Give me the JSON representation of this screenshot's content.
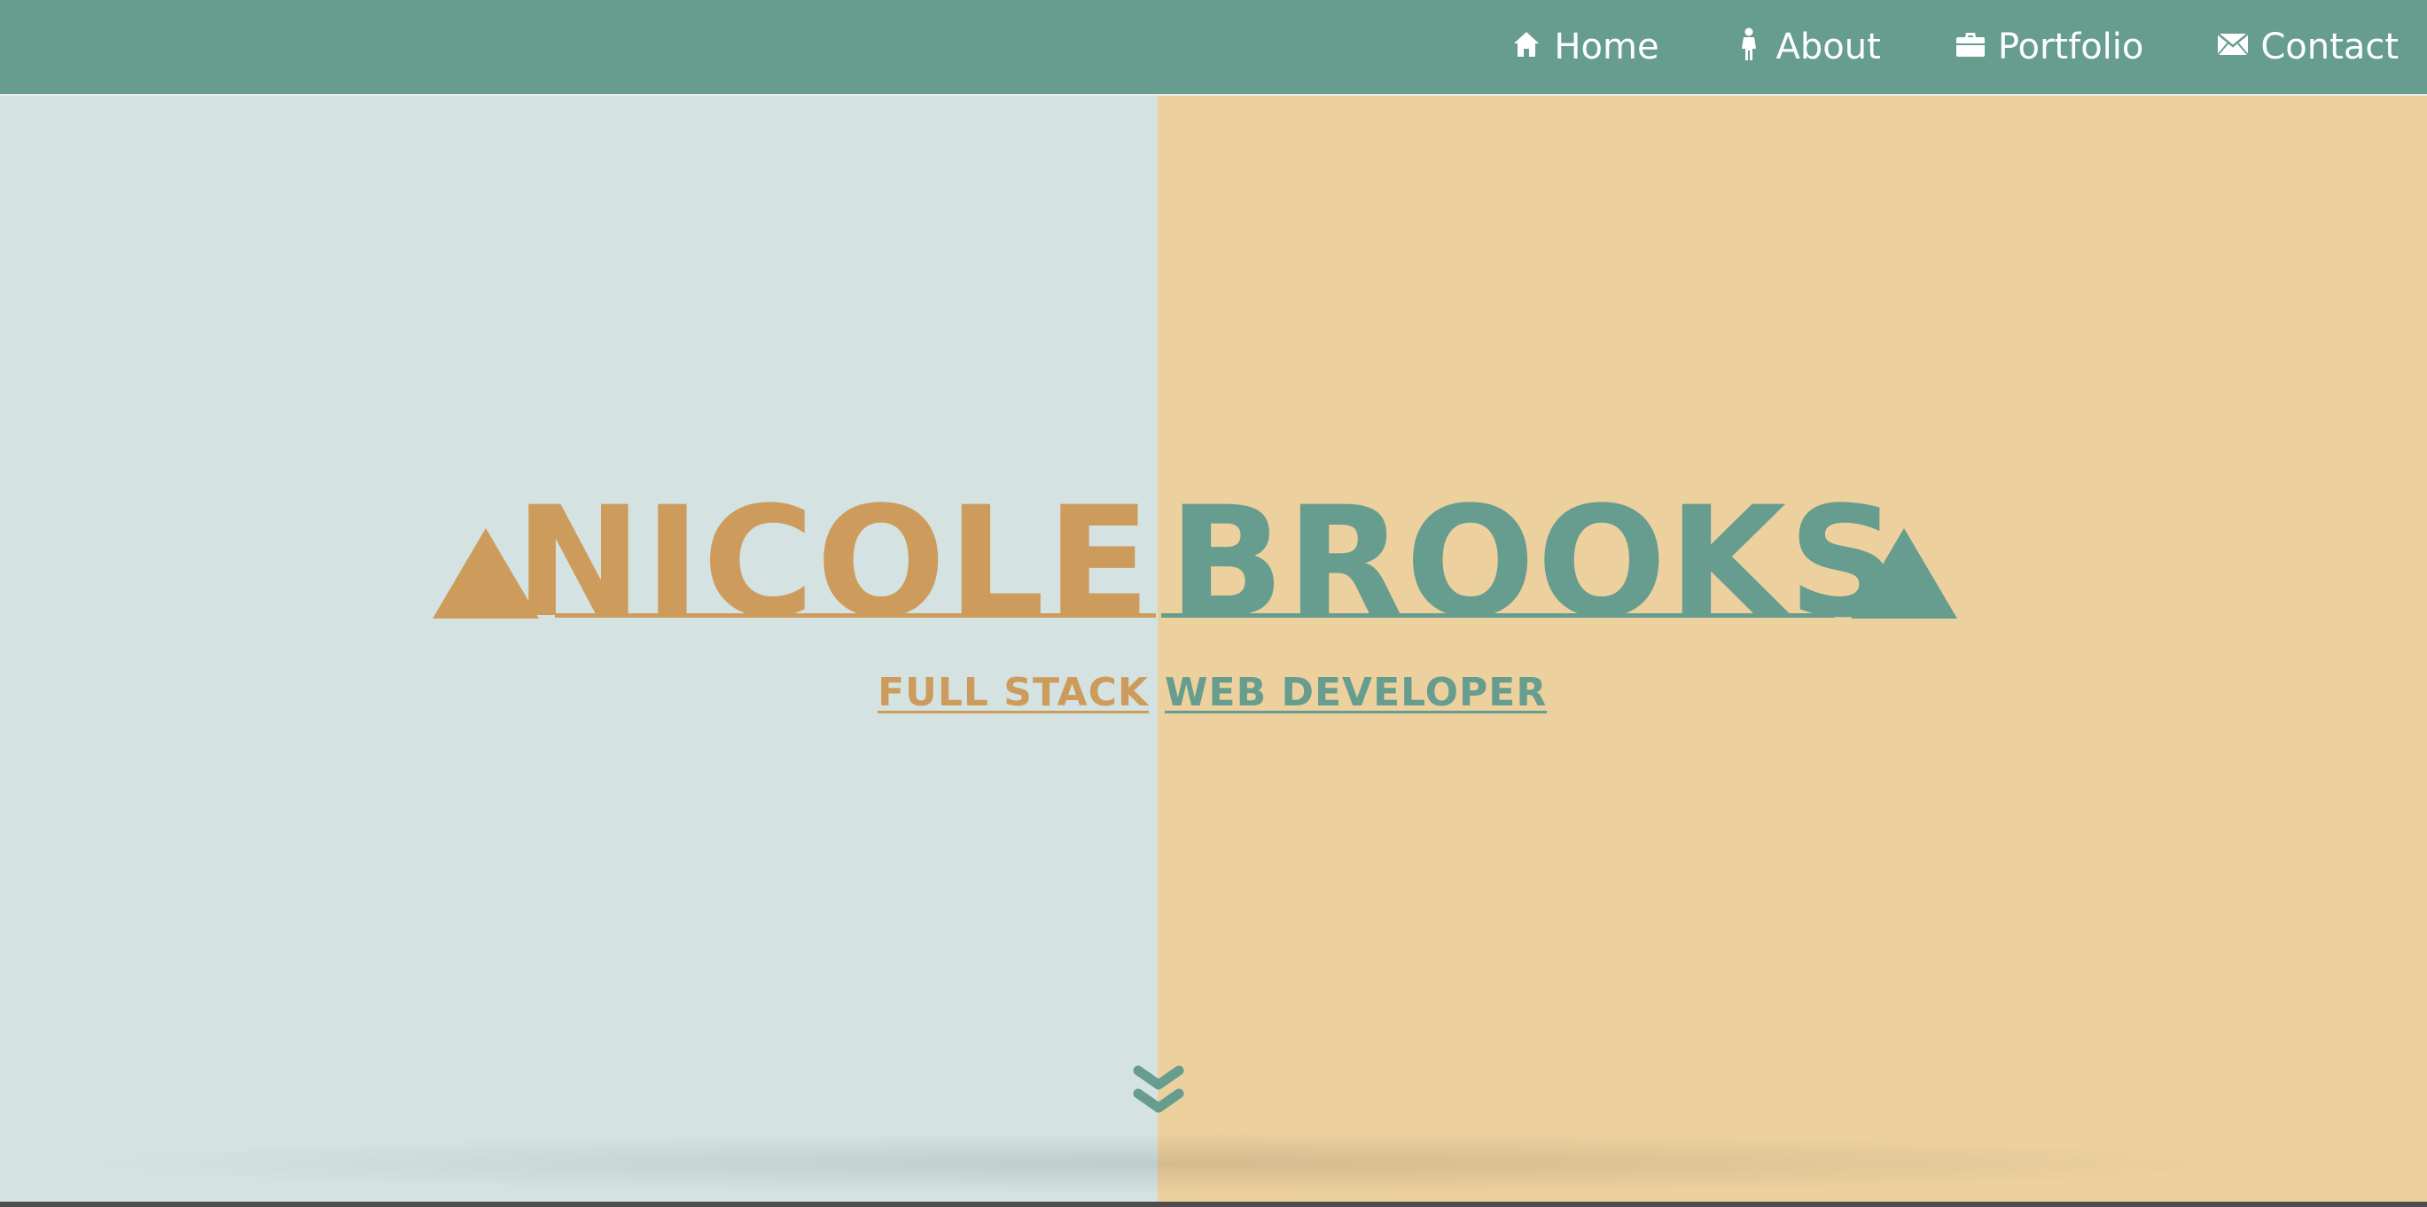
{
  "nav": {
    "items": [
      {
        "label": "Home",
        "icon": "home-icon"
      },
      {
        "label": "About",
        "icon": "person-icon"
      },
      {
        "label": "Portfolio",
        "icon": "briefcase-icon"
      },
      {
        "label": "Contact",
        "icon": "envelope-icon"
      }
    ]
  },
  "hero": {
    "first_name": "NICOLE",
    "last_name": "BROOKS",
    "subtitle_first": "FULL STACK",
    "subtitle_last": "WEB DEVELOPER",
    "scroll_icon": "double-chevron-down-icon"
  },
  "colors": {
    "nav_bg": "#669d8f",
    "teal": "#669d8f",
    "tan": "#cd9c5c",
    "left_bg": "#d4e3e1",
    "right_bg": "#ecd09e"
  }
}
